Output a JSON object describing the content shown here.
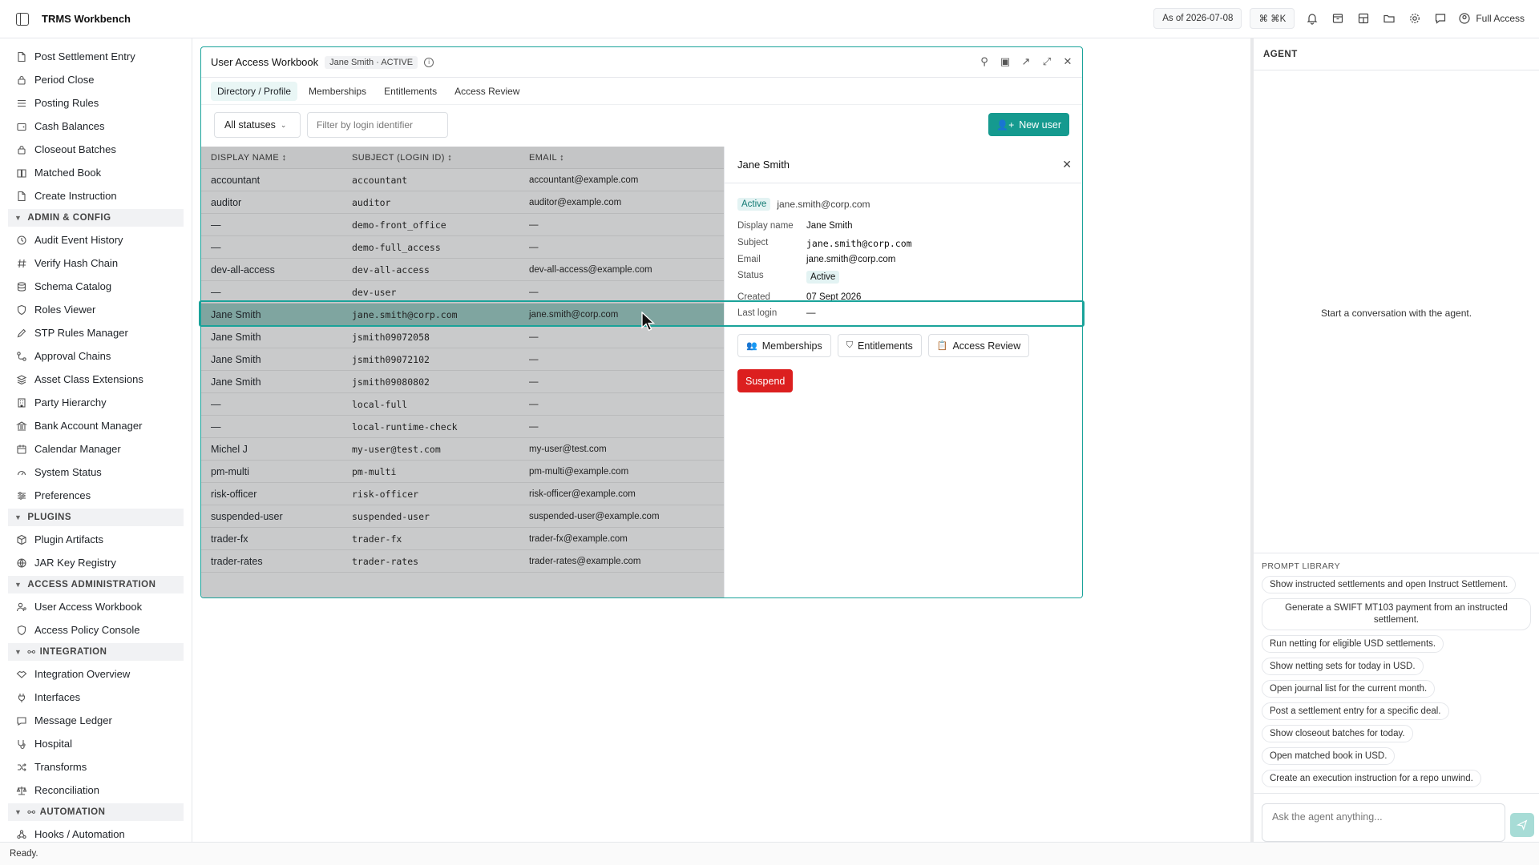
{
  "topbar": {
    "app_title": "TRMS Workbench",
    "as_of": "As of 2026-07-08",
    "shortcut": "⌘ ⌘K",
    "access": "Full Access"
  },
  "sidebar": {
    "items_top": [
      {
        "label": "Post Settlement Entry",
        "icon": "document-icon"
      },
      {
        "label": "Period Close",
        "icon": "lock-icon"
      },
      {
        "label": "Posting Rules",
        "icon": "list-icon"
      },
      {
        "label": "Cash Balances",
        "icon": "wallet-icon"
      },
      {
        "label": "Closeout Batches",
        "icon": "lock-icon"
      },
      {
        "label": "Matched Book",
        "icon": "book-icon"
      },
      {
        "label": "Create Instruction",
        "icon": "document-icon"
      }
    ],
    "section_admin": "ADMIN & CONFIG",
    "items_admin": [
      {
        "label": "Audit Event History",
        "icon": "history-icon"
      },
      {
        "label": "Verify Hash Chain",
        "icon": "hash-icon"
      },
      {
        "label": "Schema Catalog",
        "icon": "database-icon"
      },
      {
        "label": "Roles Viewer",
        "icon": "shield-icon"
      },
      {
        "label": "STP Rules Manager",
        "icon": "pencil-icon"
      },
      {
        "label": "Approval Chains",
        "icon": "workflow-icon"
      },
      {
        "label": "Asset Class Extensions",
        "icon": "layers-icon"
      },
      {
        "label": "Party Hierarchy",
        "icon": "building-icon"
      },
      {
        "label": "Bank Account Manager",
        "icon": "bank-icon"
      },
      {
        "label": "Calendar Manager",
        "icon": "calendar-icon"
      },
      {
        "label": "System Status",
        "icon": "gauge-icon"
      },
      {
        "label": "Preferences",
        "icon": "sliders-icon"
      }
    ],
    "section_plugins": "PLUGINS",
    "items_plugins": [
      {
        "label": "Plugin Artifacts",
        "icon": "package-icon"
      },
      {
        "label": "JAR Key Registry",
        "icon": "globe-icon"
      }
    ],
    "section_access": "ACCESS ADMINISTRATION",
    "items_access": [
      {
        "label": "User Access Workbook",
        "icon": "user-key-icon"
      },
      {
        "label": "Access Policy Console",
        "icon": "shield-icon"
      }
    ],
    "section_integration": "INTEGRATION",
    "items_integration": [
      {
        "label": "Integration Overview",
        "icon": "handshake-icon"
      },
      {
        "label": "Interfaces",
        "icon": "plug-icon"
      },
      {
        "label": "Message Ledger",
        "icon": "message-icon"
      },
      {
        "label": "Hospital",
        "icon": "stethoscope-icon"
      },
      {
        "label": "Transforms",
        "icon": "shuffle-icon"
      },
      {
        "label": "Reconciliation",
        "icon": "scale-icon"
      }
    ],
    "section_automation": "AUTOMATION",
    "items_automation": [
      {
        "label": "Hooks / Automation",
        "icon": "webhook-icon"
      }
    ]
  },
  "workbook": {
    "title": "User Access Workbook",
    "badge": "Jane Smith · ACTIVE",
    "tabs": [
      "Directory / Profile",
      "Memberships",
      "Entitlements",
      "Access Review"
    ],
    "status_filter": "All statuses",
    "filter_placeholder": "Filter by login identifier",
    "new_user_label": "New user",
    "columns": [
      "DISPLAY NAME",
      "SUBJECT (LOGIN ID)",
      "EMAIL"
    ],
    "rows": [
      {
        "name": "accountant",
        "subject": "accountant",
        "email": "accountant@example.com"
      },
      {
        "name": "auditor",
        "subject": "auditor",
        "email": "auditor@example.com"
      },
      {
        "name": "—",
        "subject": "demo-front_office",
        "email": "—"
      },
      {
        "name": "—",
        "subject": "demo-full_access",
        "email": "—"
      },
      {
        "name": "dev-all-access",
        "subject": "dev-all-access",
        "email": "dev-all-access@example.com"
      },
      {
        "name": "—",
        "subject": "dev-user",
        "email": "—"
      },
      {
        "name": "Jane Smith",
        "subject": "jane.smith@corp.com",
        "email": "jane.smith@corp.com",
        "selected": true
      },
      {
        "name": "Jane Smith",
        "subject": "jsmith09072058",
        "email": "—"
      },
      {
        "name": "Jane Smith",
        "subject": "jsmith09072102",
        "email": "—"
      },
      {
        "name": "Jane Smith",
        "subject": "jsmith09080802",
        "email": "—"
      },
      {
        "name": "—",
        "subject": "local-full",
        "email": "—"
      },
      {
        "name": "—",
        "subject": "local-runtime-check",
        "email": "—"
      },
      {
        "name": "Michel J",
        "subject": "my-user@test.com",
        "email": "my-user@test.com"
      },
      {
        "name": "pm-multi",
        "subject": "pm-multi",
        "email": "pm-multi@example.com"
      },
      {
        "name": "risk-officer",
        "subject": "risk-officer",
        "email": "risk-officer@example.com"
      },
      {
        "name": "suspended-user",
        "subject": "suspended-user",
        "email": "suspended-user@example.com"
      },
      {
        "name": "trader-fx",
        "subject": "trader-fx",
        "email": "trader-fx@example.com"
      },
      {
        "name": "trader-rates",
        "subject": "trader-rates",
        "email": "trader-rates@example.com"
      }
    ],
    "details": {
      "title": "Jane Smith",
      "status_badge": "Active",
      "email_top": "jane.smith@corp.com",
      "fields": [
        {
          "k": "Display name",
          "v": "Jane Smith"
        },
        {
          "k": "Subject",
          "v": "jane.smith@corp.com"
        },
        {
          "k": "Email",
          "v": "jane.smith@corp.com"
        },
        {
          "k": "Status",
          "v": "Active"
        },
        {
          "k": "Created",
          "v": "07 Sept 2026"
        },
        {
          "k": "Last login",
          "v": "—"
        }
      ],
      "buttons": [
        "Memberships",
        "Entitlements",
        "Access Review"
      ],
      "suspend_label": "Suspend"
    }
  },
  "agent": {
    "title": "AGENT",
    "empty": "Start a conversation with the agent.",
    "prompt_library_title": "PROMPT LIBRARY",
    "prompts": [
      "Show instructed settlements and open Instruct Settlement.",
      "Generate a SWIFT MT103 payment from an instructed settlement.",
      "Run netting for eligible USD settlements.",
      "Show netting sets for today in USD.",
      "Open journal list for the current month.",
      "Post a settlement entry for a specific deal.",
      "Show closeout batches for today.",
      "Open matched book in USD.",
      "Create an execution instruction for a repo unwind."
    ],
    "input_placeholder": "Ask the agent anything..."
  },
  "status_bar": "Ready.",
  "colors": {
    "accent": "#159a8f",
    "danger": "#dc1f1f",
    "selected_row": "#7fa5a0"
  }
}
